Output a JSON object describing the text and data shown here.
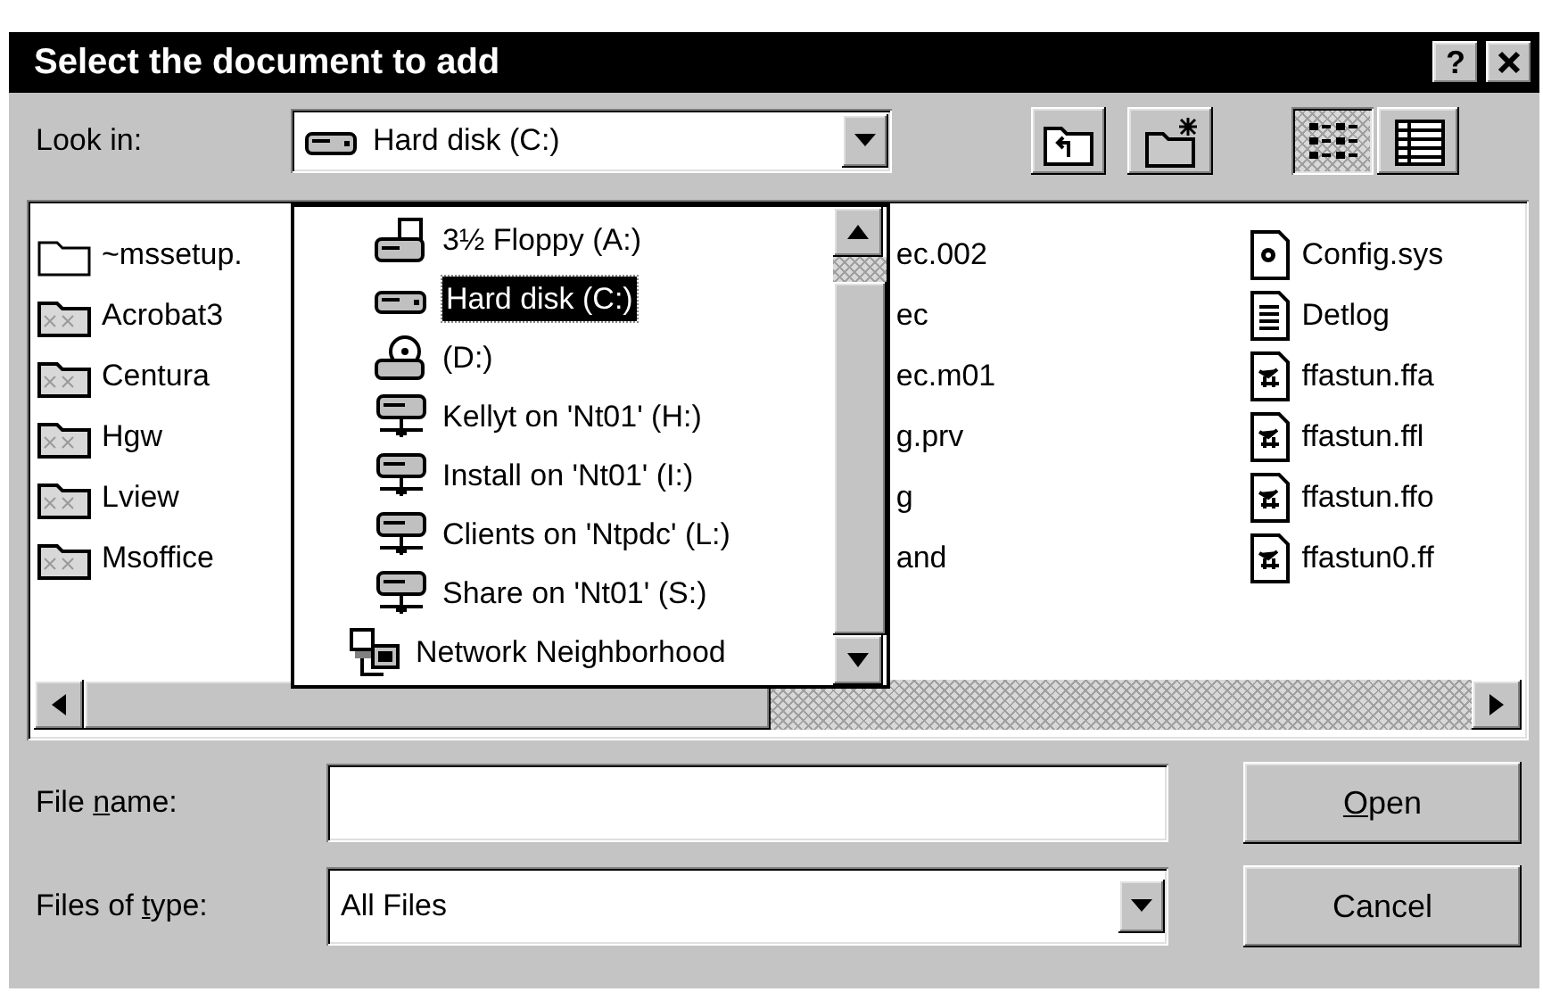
{
  "window": {
    "title": "Select the document to add",
    "help_button": "?"
  },
  "look_in": {
    "label": "Look in:",
    "value": "Hard disk (C:)",
    "kind": "harddisk"
  },
  "toolbar": [
    {
      "kind": "up-folder",
      "pressed": false
    },
    {
      "kind": "new-folder",
      "pressed": false
    },
    {
      "kind": "list-view",
      "pressed": true
    },
    {
      "kind": "details-view",
      "pressed": false
    }
  ],
  "look_in_list": [
    {
      "label": "3½ Floppy (A:)",
      "kind": "floppy",
      "selected": false
    },
    {
      "label": "Hard disk (C:)",
      "kind": "harddisk",
      "selected": true
    },
    {
      "label": "(D:)",
      "kind": "cdrom",
      "selected": false
    },
    {
      "label": "Kellyt on 'Nt01' (H:)",
      "kind": "network-drive",
      "selected": false
    },
    {
      "label": "Install on 'Nt01' (I:)",
      "kind": "network-drive",
      "selected": false
    },
    {
      "label": "Clients on 'Ntpdc' (L:)",
      "kind": "network-drive",
      "selected": false
    },
    {
      "label": "Share on 'Nt01' (S:)",
      "kind": "network-drive",
      "selected": false
    },
    {
      "label": "Network Neighborhood",
      "kind": "neighborhood",
      "selected": false
    }
  ],
  "file_list": {
    "columns": [
      {
        "items": [
          {
            "name": "~mssetup.",
            "kind": "empty-folder"
          },
          {
            "name": "Acrobat3",
            "kind": "folder"
          },
          {
            "name": "Centura",
            "kind": "folder"
          },
          {
            "name": "Hgw",
            "kind": "folder"
          },
          {
            "name": "Lview",
            "kind": "folder"
          },
          {
            "name": "Msoffice",
            "kind": "folder"
          }
        ]
      },
      {
        "items": [
          {
            "name": "ec.002",
            "kind": "hidden"
          },
          {
            "name": "ec",
            "kind": "hidden"
          },
          {
            "name": "ec.m01",
            "kind": "hidden"
          },
          {
            "name": "g.prv",
            "kind": "hidden"
          },
          {
            "name": "g",
            "kind": "hidden"
          },
          {
            "name": "and",
            "kind": "hidden"
          }
        ]
      },
      {
        "items": [
          {
            "name": "Config.sys",
            "kind": "system"
          },
          {
            "name": "Detlog",
            "kind": "text"
          },
          {
            "name": "ffastun.ffa",
            "kind": "index"
          },
          {
            "name": "ffastun.ffl",
            "kind": "index"
          },
          {
            "name": "ffastun.ffo",
            "kind": "index"
          },
          {
            "name": "ffastun0.ff",
            "kind": "index"
          }
        ]
      }
    ]
  },
  "file_name": {
    "label": {
      "before": "File ",
      "key": "n",
      "after": "ame:"
    }
  },
  "files_of_type": {
    "label": {
      "before": "Files of ",
      "key": "t",
      "after": "ype:"
    },
    "value": "All Files"
  },
  "buttons": [
    {
      "label": {
        "key": "O",
        "after": "pen"
      }
    },
    {
      "label": {
        "before": "Cancel"
      }
    }
  ]
}
